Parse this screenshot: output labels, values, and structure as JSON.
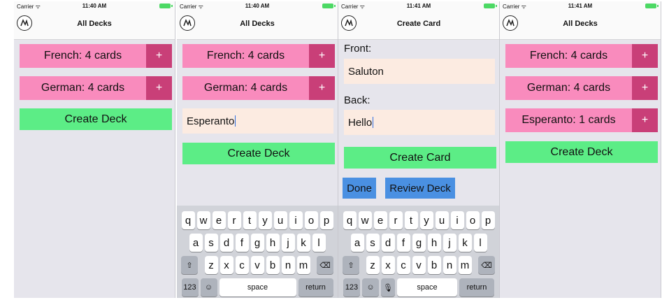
{
  "screens": [
    {
      "status": {
        "carrier": "Carrier ᯤ",
        "time": "11:40 AM"
      },
      "nav_title": "All Decks",
      "decks": [
        {
          "label": "French: 4 cards",
          "add": "+"
        },
        {
          "label": "German: 4 cards",
          "add": "+"
        }
      ],
      "create_deck_label": "Create Deck"
    },
    {
      "status": {
        "carrier": "Carrier ᯤ",
        "time": "11:40 AM"
      },
      "nav_title": "All Decks",
      "decks": [
        {
          "label": "French: 4 cards",
          "add": "+"
        },
        {
          "label": "German: 4 cards",
          "add": "+"
        }
      ],
      "new_deck_input": "Esperanto",
      "create_deck_label": "Create Deck"
    },
    {
      "status": {
        "carrier": "Carrier ᯤ",
        "time": "11:41 AM"
      },
      "nav_title": "Create Card",
      "front_label": "Front:",
      "front_value": "Saluton",
      "back_label": "Back:",
      "back_value": "Hello",
      "create_card_label": "Create Card",
      "done_label": "Done",
      "review_label": "Review Deck"
    },
    {
      "status": {
        "carrier": "Carrier ᯤ",
        "time": "11:41 AM"
      },
      "nav_title": "All Decks",
      "decks": [
        {
          "label": "French: 4 cards",
          "add": "+"
        },
        {
          "label": "German: 4 cards",
          "add": "+"
        },
        {
          "label": "Esperanto: 1 cards",
          "add": "+"
        }
      ],
      "create_deck_label": "Create Deck"
    }
  ],
  "keyboard": {
    "row1": [
      "q",
      "w",
      "e",
      "r",
      "t",
      "y",
      "u",
      "i",
      "o",
      "p"
    ],
    "row2": [
      "a",
      "s",
      "d",
      "f",
      "g",
      "h",
      "j",
      "k",
      "l"
    ],
    "row3": [
      "z",
      "x",
      "c",
      "v",
      "b",
      "n",
      "m"
    ],
    "shift": "⇧",
    "delete": "⌫",
    "numbers": "123",
    "emoji": "☺",
    "mic": "🎙",
    "space": "space",
    "return": "return"
  },
  "icons": {
    "logo": "zebra-logo-icon",
    "wifi": "wifi-icon",
    "battery": "battery-icon"
  },
  "colors": {
    "deck": "#f98bbd",
    "add": "#c93f78",
    "green": "#5ced86",
    "field": "#fcebe1",
    "blue": "#4a90e2"
  }
}
